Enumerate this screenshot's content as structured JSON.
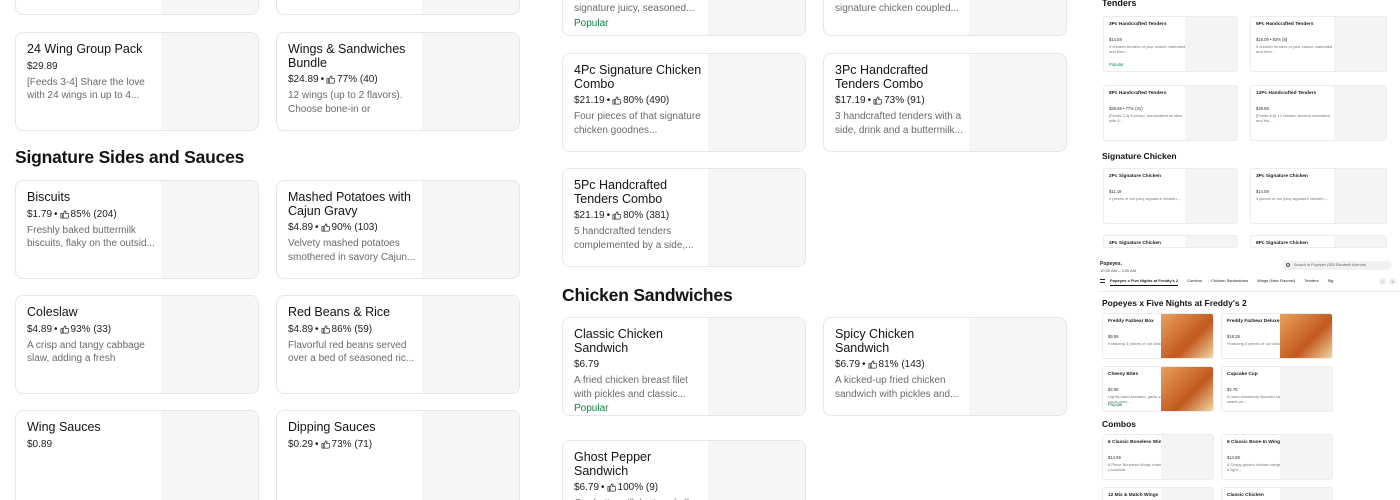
{
  "panel_a": {
    "top_cards": [
      {
        "name": "24 Wing Group Pack",
        "price": "$29.89",
        "rating": "",
        "desc": "[Feeds 3-4] Share the love with 24 wings in up to 4...",
        "tag": ""
      },
      {
        "name": "Wings & Sandwiches Bundle",
        "price": "$24.89",
        "rating": "77% (40)",
        "desc": "12 wings (up to 2 flavors). Choose bone-in or boneles...",
        "tag": ""
      }
    ],
    "section_title": "Signature Sides and Sauces",
    "cards": [
      {
        "name": "Biscuits",
        "price": "$1.79",
        "rating": "85% (204)",
        "desc": "Freshly baked buttermilk biscuits, flaky on the outsid...",
        "tag": ""
      },
      {
        "name": "Mashed Potatoes with Cajun Gravy",
        "price": "$4.89",
        "rating": "90% (103)",
        "desc": "Velvety mashed potatoes smothered in savory Cajun...",
        "tag": ""
      },
      {
        "name": "Coleslaw",
        "price": "$4.89",
        "rating": "93% (33)",
        "desc": "A crisp and tangy cabbage slaw, adding a fresh crunch...",
        "tag": ""
      },
      {
        "name": "Red Beans & Rice",
        "price": "$4.89",
        "rating": "86% (59)",
        "desc": "Flavorful red beans served over a bed of seasoned ric...",
        "tag": ""
      },
      {
        "name": "Wing Sauces",
        "price": "$0.89",
        "rating": "",
        "desc": "",
        "tag": ""
      },
      {
        "name": "Dipping Sauces",
        "price": "$0.29",
        "rating": "73% (71)",
        "desc": "",
        "tag": ""
      }
    ]
  },
  "panel_b": {
    "top_cards": [
      {
        "name": "",
        "price": "",
        "rating": "",
        "desc": "signature juicy, seasoned...",
        "tag": "Popular"
      },
      {
        "name": "",
        "price": "",
        "rating": "",
        "desc": "signature chicken coupled...",
        "tag": ""
      }
    ],
    "cards": [
      {
        "name": "4Pc Signature Chicken Combo",
        "price": "$21.19",
        "rating": "80% (490)",
        "desc": "Four pieces of that signature chicken goodnes...",
        "tag": ""
      },
      {
        "name": "3Pc Handcrafted Tenders Combo",
        "price": "$17.19",
        "rating": "73% (91)",
        "desc": "3 handcrafted tenders with a side, drink and a buttermilk...",
        "tag": ""
      },
      {
        "name": "5Pc Handcrafted Tenders Combo",
        "price": "$21.19",
        "rating": "80% (381)",
        "desc": "5 handcrafted tenders complemented by a side,...",
        "tag": ""
      }
    ],
    "section_title": "Chicken Sandwiches",
    "sandwiches": [
      {
        "name": "Classic Chicken Sandwich",
        "price": "$6.79",
        "rating": "",
        "desc": "A fried chicken breast filet with pickles and classic...",
        "tag": "Popular"
      },
      {
        "name": "Spicy Chicken Sandwich",
        "price": "$6.79",
        "rating": "81% (143)",
        "desc": "A kicked-up fried chicken sandwich with pickles and...",
        "tag": ""
      },
      {
        "name": "Ghost Pepper Sandwich",
        "price": "$6.79",
        "rating": "100% (9)",
        "desc": "Our buttermilk battered all",
        "tag": ""
      }
    ]
  },
  "panel_c": {
    "section_tenders": "Tenders",
    "tenders": [
      {
        "name": "3Pc Handcrafted Tenders",
        "meta": "$14.59",
        "desc": "3 chicken tenders of your choice marinated and fried...",
        "tag": "Popular"
      },
      {
        "name": "5Pc Handcrafted Tenders",
        "meta": "$18.09 • 83% (8)",
        "desc": "5 chicken tenders of your choice marinated and fried...",
        "tag": ""
      },
      {
        "name": "8Pc Handcrafted Tenders",
        "meta": "$28.69 • 77% (31)",
        "desc": "[Feeds 3-4] 8 plump, handcrafted tenders with 3...",
        "tag": ""
      },
      {
        "name": "12Pc Handcrafted Tenders",
        "meta": "$39.89",
        "desc": "[Feeds 4-6] 12 chicken tenders marinated and frie...",
        "tag": ""
      }
    ],
    "section_signature": "Signature Chicken",
    "signature": [
      {
        "name": "2Pc Signature Chicken",
        "meta": "$11.19",
        "desc": "2 pieces of our juicy signature chicken,...",
        "tag": ""
      },
      {
        "name": "3Pc Signature Chicken",
        "meta": "$14.59",
        "desc": "3 pieces of our juicy signature chicken,...",
        "tag": ""
      },
      {
        "name": "4Pc Signature Chicken",
        "meta": "",
        "desc": "",
        "tag": ""
      },
      {
        "name": "8Pc Signature Chicken",
        "meta": "",
        "desc": "",
        "tag": ""
      }
    ],
    "browser": {
      "brand": "Popeyes.",
      "sub": "10:30 AM – 3:30 AM",
      "search_placeholder": "Search in Popeyes (305 Elizabeth Avenue)",
      "tabs": [
        "Popeyes x Five Nights at Freddy's 2",
        "Combos",
        "Chicken Sandwiches",
        "Wings (New Flavors!)",
        "Tenders",
        "Sig"
      ],
      "arrow_left": "‹",
      "arrow_right": "›"
    },
    "section_fnaf": "Popeyes x Five Nights at Freddy's 2",
    "fnaf": [
      {
        "name": "Freddy Fazbear Box",
        "meta": "$9.59",
        "desc": "Featuring 3 pieces of our classic or spicy...",
        "tag": ""
      },
      {
        "name": "Freddy Fazbear Deluxe Box",
        "meta": "$18.29",
        "desc": "Featuring 5 pieces of our classic or spicy...",
        "tag": ""
      },
      {
        "name": "Cheesy Bites",
        "meta": "$4.99",
        "desc": "Lightly hand-breaded, garlic-crusted cheese curds mad...",
        "tag": "Popular"
      },
      {
        "name": "Cupcake Cup",
        "meta": "$4.79",
        "desc": "A hand strawberry flavored cake topped with sweet po...",
        "tag": ""
      }
    ],
    "section_combos": "Combos",
    "combos": [
      {
        "name": "6 Classic Boneless Wings Combo",
        "meta": "$14.99",
        "desc": "6 Piece Boneless Wings marinated in Louisiana...",
        "tag": ""
      },
      {
        "name": "6 Classic Bone-In Wings Combo",
        "meta": "$14.99",
        "desc": "6 Crispy golden chicken wings marinated in a light...",
        "tag": ""
      },
      {
        "name": "12 Mix & Match Wings",
        "meta": "",
        "desc": "",
        "tag": ""
      },
      {
        "name": "Classic Chicken",
        "meta": "",
        "desc": "",
        "tag": ""
      }
    ]
  }
}
